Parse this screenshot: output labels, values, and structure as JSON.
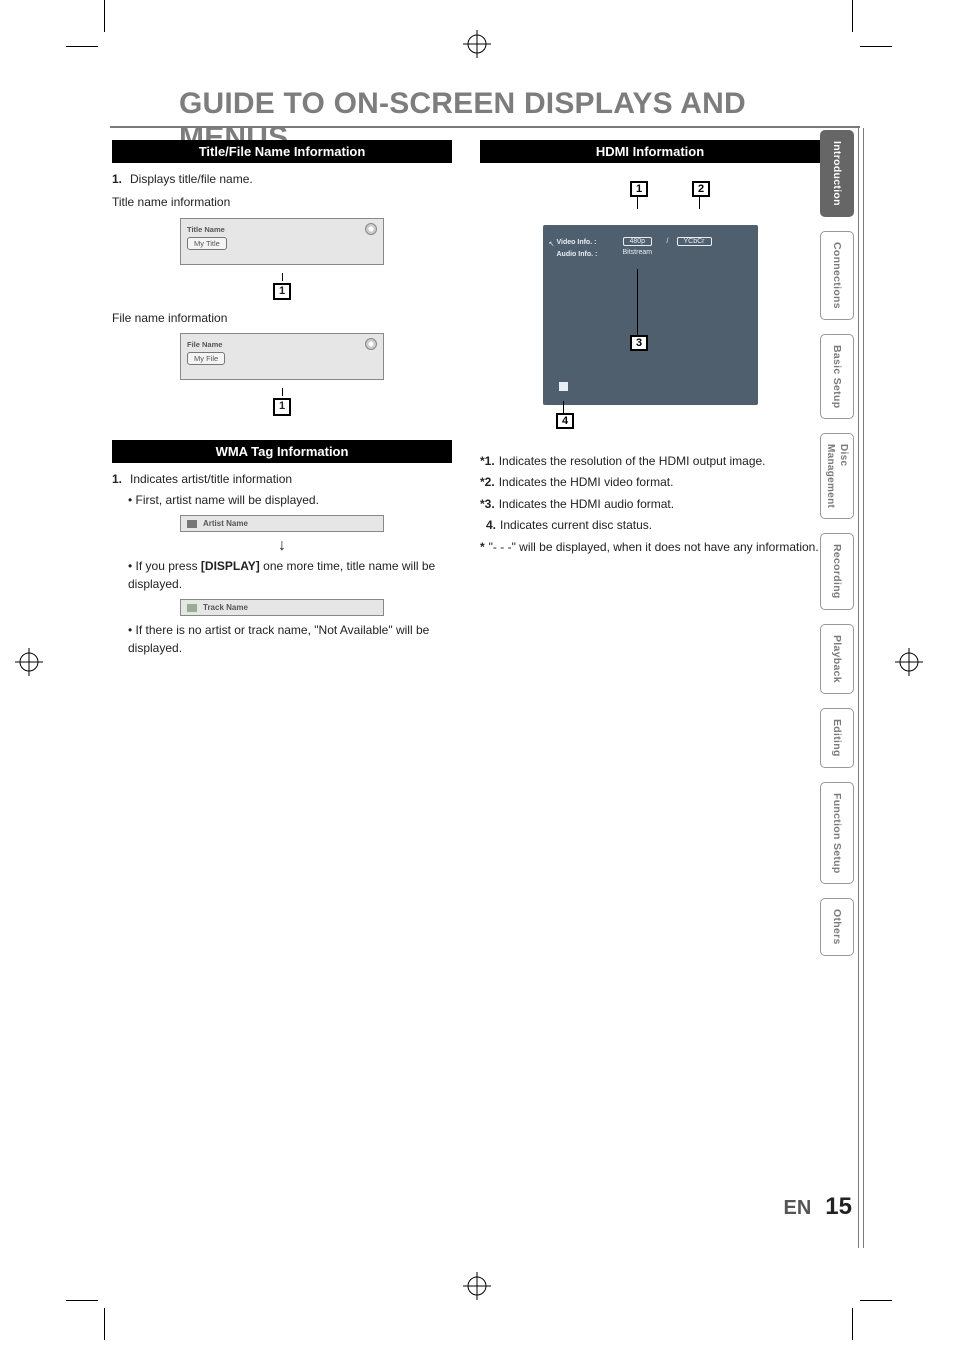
{
  "page": {
    "title": "GUIDE TO ON-SCREEN DISPLAYS AND MENUS",
    "lang": "EN",
    "number": "15"
  },
  "tabs": [
    {
      "label": "Introduction",
      "active": true
    },
    {
      "label": "Connections",
      "active": false
    },
    {
      "label": "Basic Setup",
      "active": false
    },
    {
      "label": "Disc",
      "label2": "Management",
      "active": false,
      "two": true
    },
    {
      "label": "Recording",
      "active": false
    },
    {
      "label": "Playback",
      "active": false
    },
    {
      "label": "Editing",
      "active": false
    },
    {
      "label": "Function Setup",
      "active": false
    },
    {
      "label": "Others",
      "active": false
    }
  ],
  "left": {
    "section1_title": "Title/File Name Information",
    "item1_num": "1.",
    "item1_text": "Displays title/file name.",
    "title_name_label": "Title name information",
    "osd_title_hdr": "Title Name",
    "osd_title_val": "My Title",
    "file_name_label": "File name information",
    "osd_file_hdr": "File Name",
    "osd_file_val": "My File",
    "callout1": "1",
    "section2_title": "WMA Tag Information",
    "s2_item1_num": "1.",
    "s2_item1_text": "Indicates artist/title information",
    "s2_b1": "• First, artist name will be displayed.",
    "osd_artist": "Artist Name",
    "s2_b2a": "• If you press ",
    "s2_b2_key": "[DISPLAY]",
    "s2_b2b": " one more time, title name will be displayed.",
    "osd_track": "Track Name",
    "s2_b3": "• If there is no artist or track name, \"Not Available\" will be displayed."
  },
  "right": {
    "section_title": "HDMI Information",
    "hdmi": {
      "video_label": "Video Info.   :",
      "audio_label": "Audio Info.   :",
      "res": "480p",
      "fmt": "YCbCr",
      "aud": "Bitstream"
    },
    "c1": "1",
    "c2": "2",
    "c3": "3",
    "c4": "4",
    "n1_pre": "*1.",
    "n1": " Indicates the resolution of the HDMI output image.",
    "n2_pre": "*2.",
    "n2": " Indicates the HDMI video format.",
    "n3_pre": "*3.",
    "n3": " Indicates the HDMI audio format.",
    "n4_pre": "4.",
    "n4": " Indicates current disc status.",
    "star_pre": "*",
    "star": " \"- - -\" will be displayed, when it does not have any information."
  }
}
